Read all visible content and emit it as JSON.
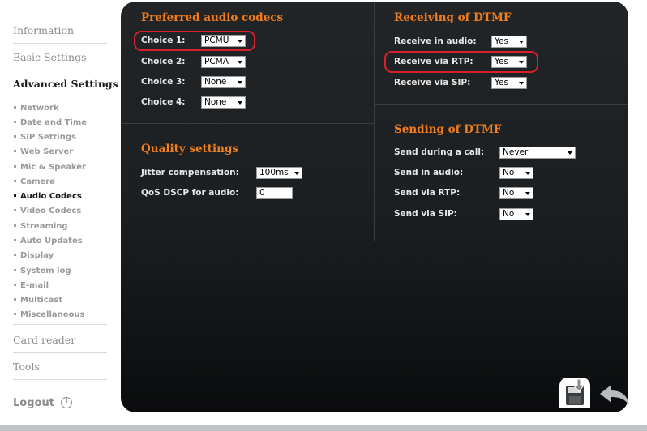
{
  "sidebar": {
    "sections": [
      "Information",
      "Basic Settings",
      "Advanced Settings",
      "Card reader",
      "Tools"
    ],
    "active_section": "Advanced Settings",
    "subitems": [
      "Network",
      "Date and Time",
      "SIP Settings",
      "Web Server",
      "Mic & Speaker",
      "Camera",
      "Audio Codecs",
      "Video Codecs",
      "Streaming",
      "Auto Updates",
      "Display",
      "System log",
      "E-mail",
      "Multicast",
      "Miscellaneous"
    ],
    "active_subitem": "Audio Codecs",
    "logout": "Logout"
  },
  "codecs": {
    "title": "Preferred audio codecs",
    "choices": [
      {
        "label": "Choice 1:",
        "value": "PCMU"
      },
      {
        "label": "Choice 2:",
        "value": "PCMA"
      },
      {
        "label": "Choice 3:",
        "value": "None"
      },
      {
        "label": "Choice 4:",
        "value": "None"
      }
    ]
  },
  "quality": {
    "title": "Quality settings",
    "jitter_label": "Jitter compensation:",
    "jitter_value": "100ms",
    "qos_label": "QoS DSCP for audio:",
    "qos_value": "0"
  },
  "receiving": {
    "title": "Receiving of DTMF",
    "rows": [
      {
        "label": "Receive in audio:",
        "value": "Yes"
      },
      {
        "label": "Receive via RTP:",
        "value": "Yes"
      },
      {
        "label": "Receive via SIP:",
        "value": "Yes"
      }
    ]
  },
  "sending": {
    "title": "Sending of DTMF",
    "rows": [
      {
        "label": "Send during a call:",
        "value": "Never"
      },
      {
        "label": "Send in audio:",
        "value": "No"
      },
      {
        "label": "Send via RTP:",
        "value": "No"
      },
      {
        "label": "Send via SIP:",
        "value": "No"
      }
    ]
  },
  "colors": {
    "accent": "#f07d1e",
    "highlight": "#d8202a",
    "panel": "#1c1f21"
  },
  "icons": [
    "info-circle-icon",
    "save-icon",
    "back-arrow-icon",
    "dropdown-arrow-icon"
  ]
}
